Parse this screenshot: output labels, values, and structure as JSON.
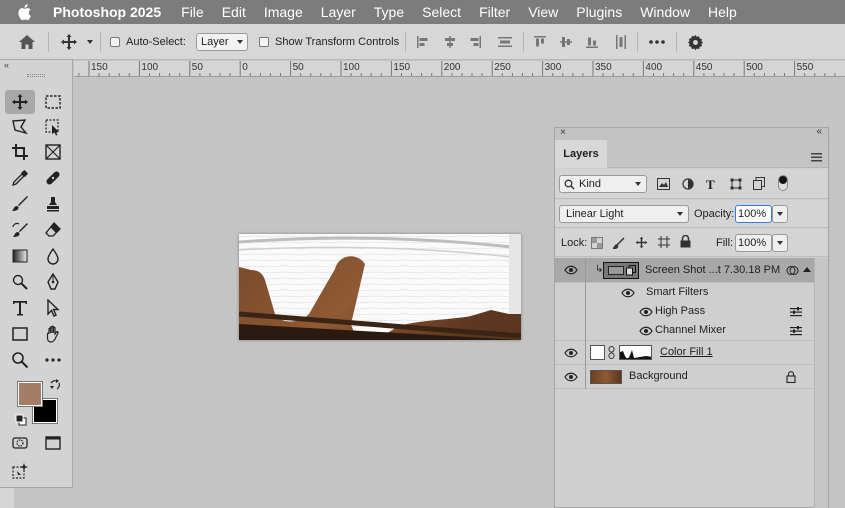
{
  "menubar": {
    "app_name": "Photoshop 2025",
    "items": [
      "File",
      "Edit",
      "Image",
      "Layer",
      "Type",
      "Select",
      "Filter",
      "View",
      "Plugins",
      "Window",
      "Help"
    ]
  },
  "options_bar": {
    "auto_select_label": "Auto-Select:",
    "auto_select_target": "Layer",
    "transform_controls_label": "Show Transform Controls"
  },
  "ruler": {
    "ticks": [
      "150",
      "100",
      "50",
      "0",
      "50",
      "100",
      "150",
      "200",
      "250",
      "300",
      "350",
      "400",
      "450",
      "500",
      "550"
    ]
  },
  "colors": {
    "foreground": "#a37d68",
    "background": "#000000",
    "selected_layer": "#a8a8a8"
  },
  "layers_panel": {
    "tab_label": "Layers",
    "filter_kind": "Kind",
    "blend_mode": "Linear Light",
    "opacity_label": "Opacity:",
    "opacity_value": "100%",
    "lock_label": "Lock:",
    "fill_label": "Fill:",
    "fill_value": "100%",
    "layers": [
      {
        "name": "Screen Shot ...t 7.30.18 PM",
        "selected": true
      },
      {
        "name": "Smart Filters"
      },
      {
        "name": "High Pass"
      },
      {
        "name": "Channel Mixer"
      },
      {
        "name": "Color Fill 1"
      },
      {
        "name": "Background"
      }
    ]
  }
}
